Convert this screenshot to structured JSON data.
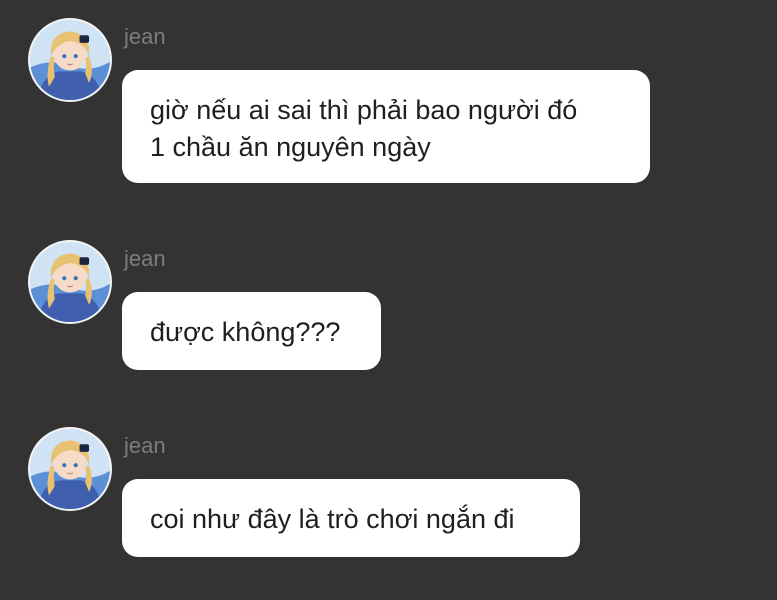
{
  "colors": {
    "background": "#333333",
    "bubble": "#ffffff",
    "text": "#1f1f1f",
    "sender": "#7d7d7d"
  },
  "messages": [
    {
      "sender": "jean",
      "avatar_icon": "anime-character-avatar-icon",
      "text": "giờ nếu ai sai thì phải bao người đó\n1 chầu ăn nguyên ngày"
    },
    {
      "sender": "jean",
      "avatar_icon": "anime-character-avatar-icon",
      "text": "được không???"
    },
    {
      "sender": "jean",
      "avatar_icon": "anime-character-avatar-icon",
      "text": "coi như đây là trò chơi ngắn đi"
    }
  ]
}
